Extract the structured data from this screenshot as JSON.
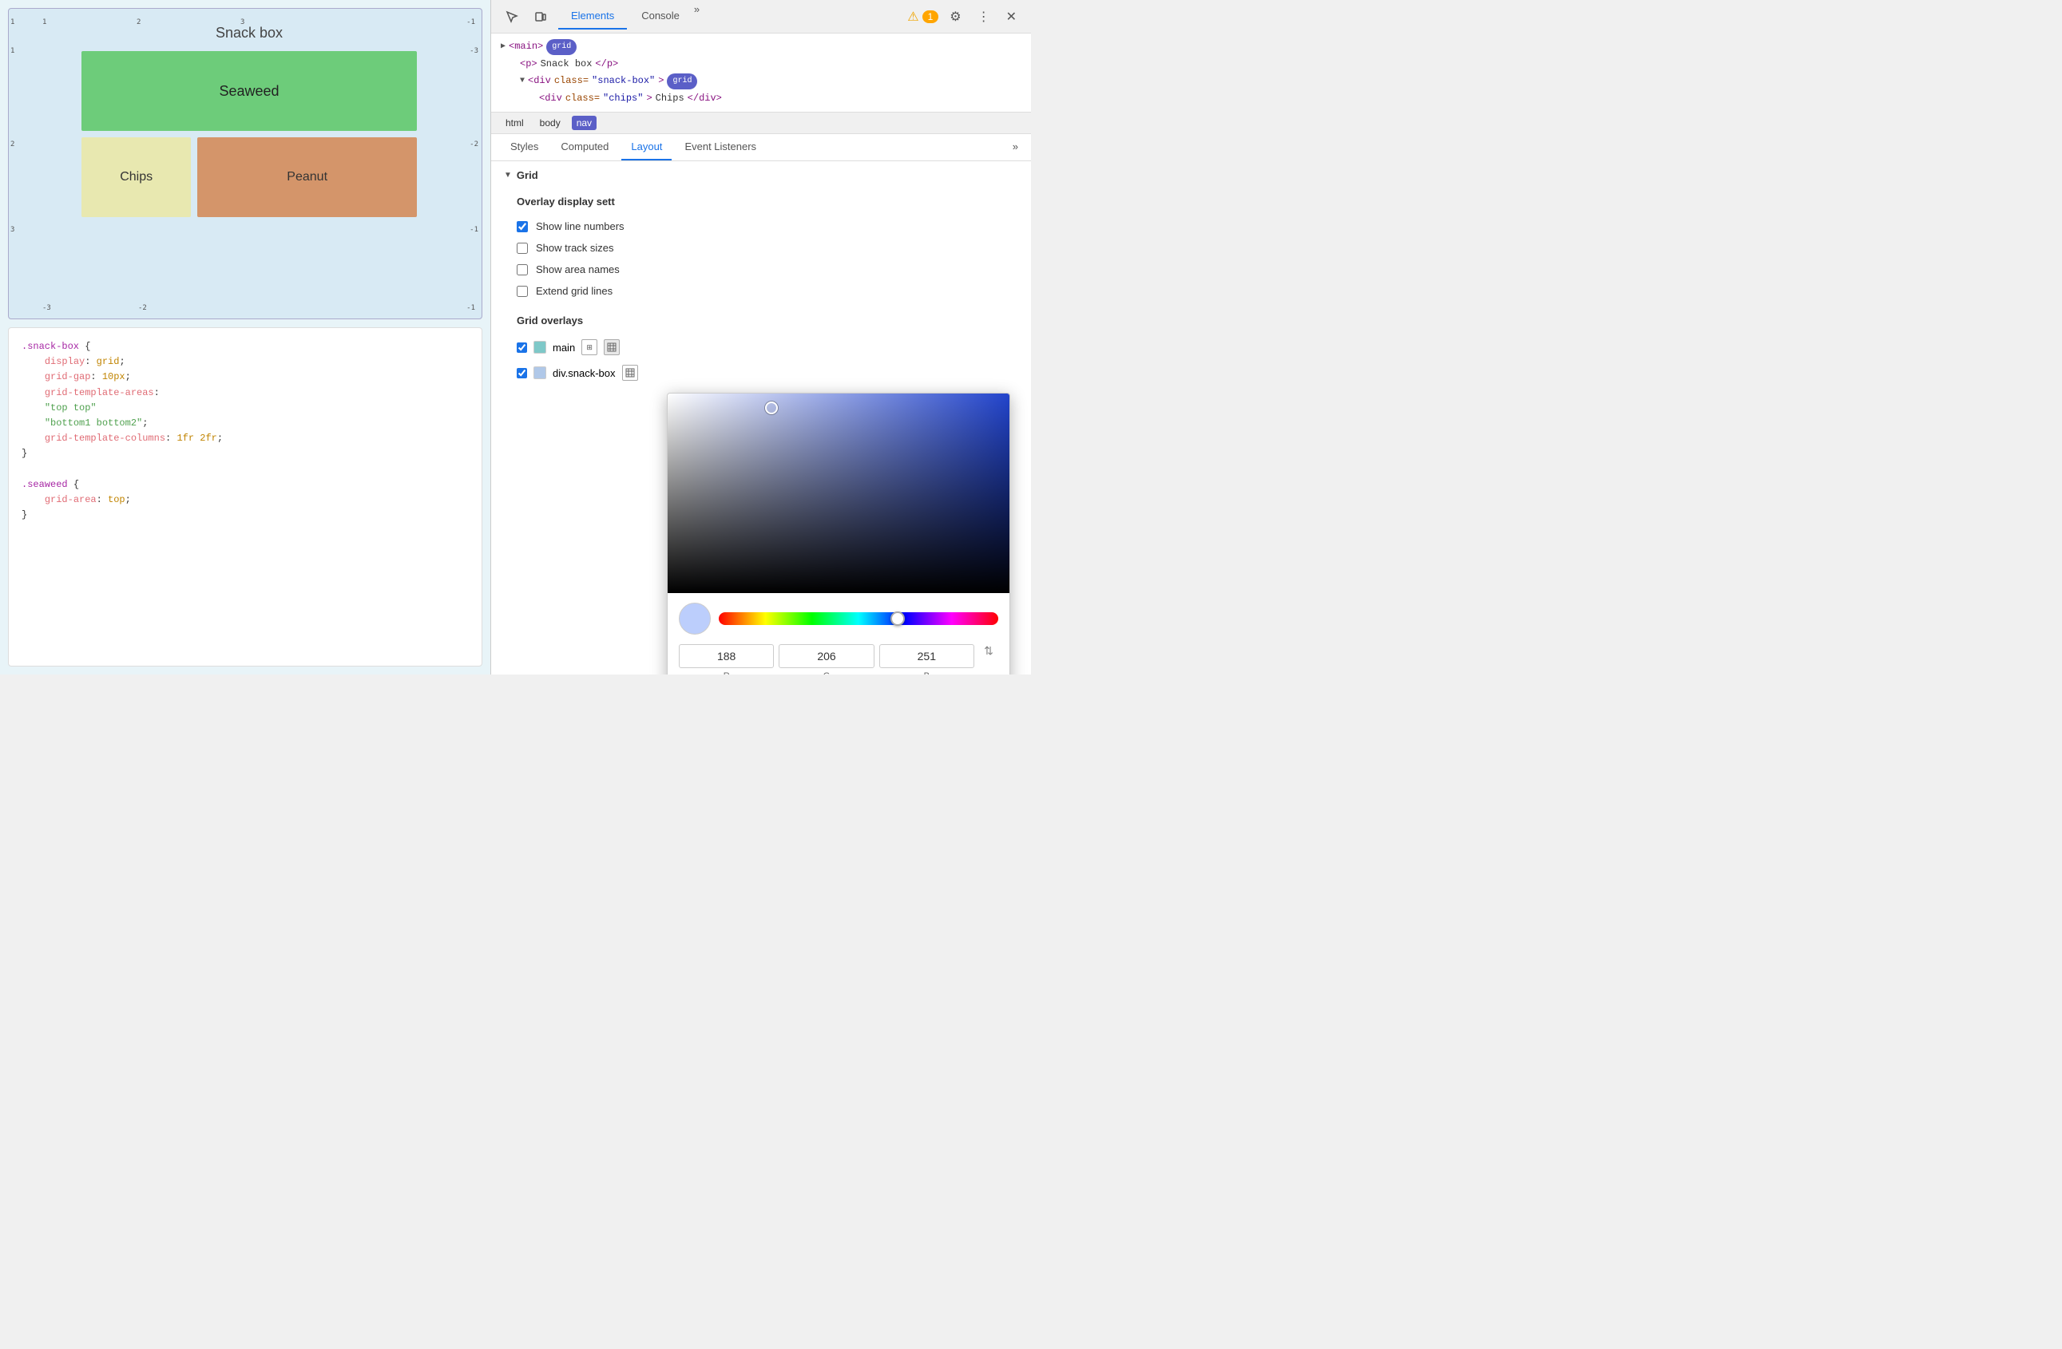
{
  "left_panel": {
    "title": "Snack box",
    "cells": {
      "seaweed": "Seaweed",
      "chips": "Chips",
      "peanut": "Peanut"
    },
    "code": {
      "block1_selector": ".snack-box",
      "block1_props": [
        {
          "prop": "display",
          "value": "grid"
        },
        {
          "prop": "grid-gap",
          "value": "10px"
        },
        {
          "prop": "grid-template-areas",
          "value": null
        },
        {
          "str1": "\"top top\""
        },
        {
          "str2": "\"bottom1 bottom2\""
        },
        {
          "prop2": "grid-template-columns",
          "value2": "1fr 2fr"
        }
      ],
      "block2_selector": ".seaweed",
      "block2_props": [
        {
          "prop": "grid-area",
          "value": "top"
        }
      ]
    }
  },
  "devtools": {
    "header": {
      "tabs": [
        "Elements",
        "Console"
      ],
      "active_tab": "Elements",
      "more_label": "»",
      "warning_count": "1",
      "gear_icon": "⚙",
      "dots_icon": "⋮",
      "close_icon": "✕"
    },
    "dom_tree": {
      "line1": "▶ <main>",
      "badge1": "grid",
      "line2": "<p>Snack box</p>",
      "line3": "▼ <div class=\"snack-box\">",
      "badge2": "grid",
      "line4": "<div class=\"chips\">Chips</div>"
    },
    "breadcrumb": {
      "items": [
        "html",
        "body",
        "nav"
      ],
      "active": "nav"
    },
    "sub_tabs": {
      "tabs": [
        "Styles",
        "Computed",
        "Layout",
        "Event Listeners"
      ],
      "active": "Layout",
      "more": "»"
    },
    "layout": {
      "grid_section": "Grid",
      "overlay_settings_title": "Overlay display sett",
      "checkboxes": [
        {
          "label": "Show line numbers",
          "checked": true
        },
        {
          "label": "Show track sizes",
          "checked": false
        },
        {
          "label": "Show area names",
          "checked": false
        },
        {
          "label": "Extend grid lines",
          "checked": false
        }
      ],
      "grid_overlays_title": "Grid overlays",
      "overlays": [
        {
          "label": "main",
          "color": "#7ec8c8",
          "checked": true
        },
        {
          "label": "div.snack-box",
          "color": "#b0c8e8",
          "checked": true
        }
      ]
    },
    "color_picker": {
      "r": "188",
      "g": "206",
      "b": "251",
      "r_label": "R",
      "g_label": "G",
      "b_label": "B"
    }
  }
}
